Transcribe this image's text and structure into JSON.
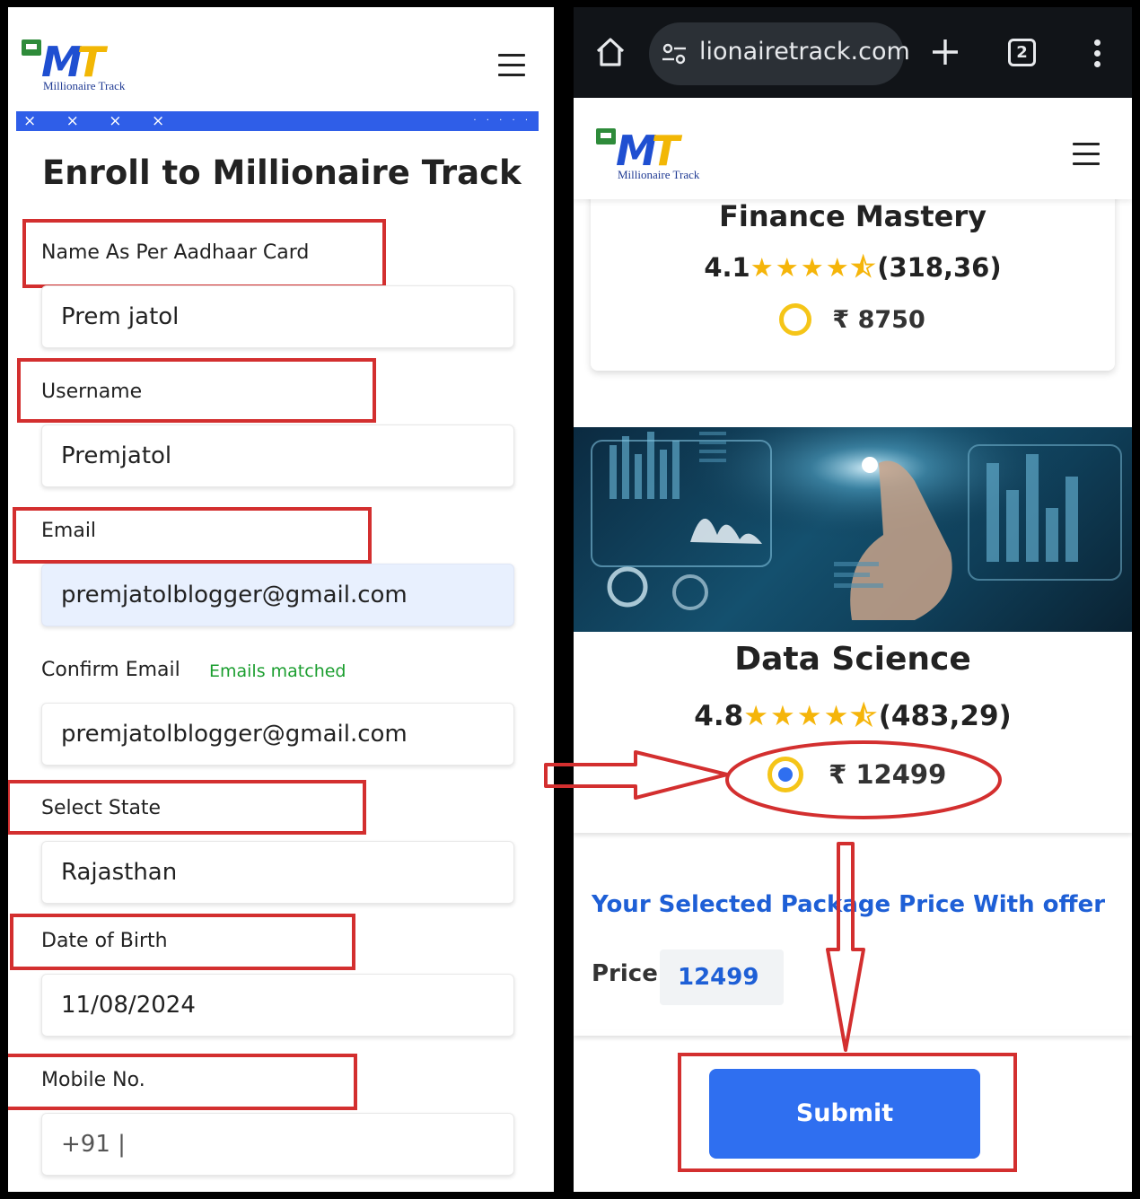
{
  "colors": {
    "accent": "#2f6ff0",
    "highlight": "#d32f2f",
    "success": "#1b9e2f",
    "link": "#1e5fd6",
    "star": "#f5b50a"
  },
  "brand": {
    "mark_m": "M",
    "mark_t": "T",
    "name": "Millionaire Track"
  },
  "left_form": {
    "banner_marks": "× × × ×",
    "banner_dots": "· · · · ·",
    "title": "Enroll to Millionaire Track",
    "fields": {
      "name_label": "Name As Per Aadhaar Card",
      "name_value": "Prem jatol",
      "username_label": "Username",
      "username_value": "Premjatol",
      "email_label": "Email",
      "email_value": "premjatolblogger@gmail.com",
      "confirm_email_label": "Confirm Email",
      "confirm_email_status": "Emails matched",
      "confirm_email_value": "premjatolblogger@gmail.com",
      "state_label": "Select State",
      "state_value": "Rajasthan",
      "dob_label": "Date of Birth",
      "dob_value": "11/08/2024",
      "mobile_label": "Mobile No.",
      "mobile_value": "+91 |"
    }
  },
  "browser": {
    "url": "lionairetrack.com",
    "tab_count": "2",
    "icons": [
      "home-icon",
      "site-settings-icon",
      "new-tab-icon",
      "tab-switcher-icon",
      "more-menu-icon"
    ]
  },
  "courses": [
    {
      "title": "Finance Mastery",
      "rating": "4.1",
      "stars": "★★★★⯪",
      "reviews": "(318,36)",
      "price": "₹ 8750",
      "selected": false
    },
    {
      "title": "Data Science",
      "rating": "4.8",
      "stars": "★★★★⯪",
      "reviews": "(483,29)",
      "price": "₹ 12499",
      "selected": true
    }
  ],
  "package": {
    "title": "Your Selected Package Price With offer",
    "price_label": "Price:",
    "price_value": "12499"
  },
  "submit_label": "Submit"
}
